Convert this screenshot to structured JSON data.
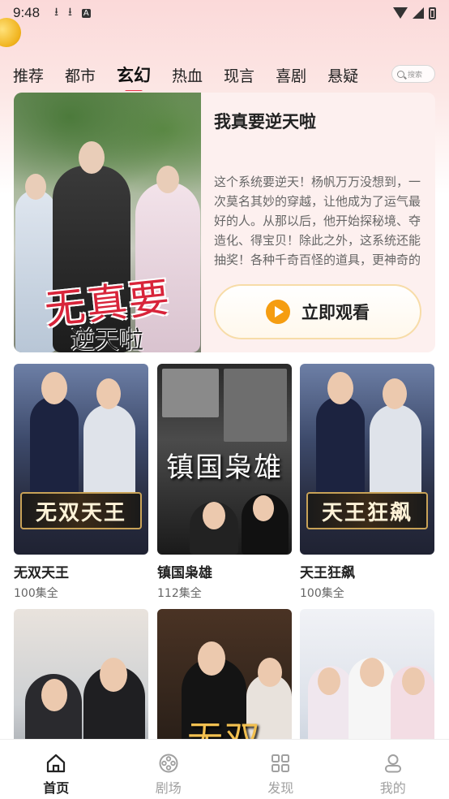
{
  "status_bar": {
    "time": "9:48",
    "icons": [
      "download-icon",
      "download-icon",
      "font-icon"
    ],
    "right_icons": [
      "wifi-icon",
      "signal-icon",
      "battery-icon"
    ]
  },
  "tabs": [
    {
      "label": "推荐",
      "active": false
    },
    {
      "label": "都市",
      "active": false
    },
    {
      "label": "玄幻",
      "active": true
    },
    {
      "label": "热血",
      "active": false
    },
    {
      "label": "现言",
      "active": false
    },
    {
      "label": "喜剧",
      "active": false
    },
    {
      "label": "悬疑",
      "active": false
    }
  ],
  "search": {
    "placeholder": "搜索"
  },
  "featured": {
    "poster_title": "无真要",
    "poster_subtitle": "逆天啦",
    "title": "我真要逆天啦",
    "description": "这个系统要逆天！杨帆万万没想到，一次莫名其妙的穿越，让他成为了运气最好的人。从那以后，他开始探秘境、夺造化、得宝贝！除此之外，这系统还能抽奖！各种千奇百怪的道具，更神奇的是，还",
    "watch_label": "立即观看"
  },
  "cards": [
    {
      "name": "无双天王",
      "episodes": "100集全",
      "poster_text": "无双天王"
    },
    {
      "name": "镇国枭雄",
      "episodes": "112集全",
      "poster_text": "镇国枭雄"
    },
    {
      "name": "天王狂飙",
      "episodes": "100集全",
      "poster_text": "天王狂飙"
    },
    {
      "name": "",
      "episodes": "",
      "poster_text": ""
    },
    {
      "name": "",
      "episodes": "",
      "poster_text": "无双"
    },
    {
      "name": "",
      "episodes": "",
      "poster_text": ""
    }
  ],
  "bottom_nav": [
    {
      "label": "首页",
      "icon": "home-icon",
      "active": true
    },
    {
      "label": "剧场",
      "icon": "film-reel-icon",
      "active": false
    },
    {
      "label": "发现",
      "icon": "grid-icon",
      "active": false
    },
    {
      "label": "我的",
      "icon": "user-icon",
      "active": false
    }
  ],
  "colors": {
    "accent": "#e8344a",
    "play": "#f59d11",
    "background_top": "#fbd9d9"
  }
}
